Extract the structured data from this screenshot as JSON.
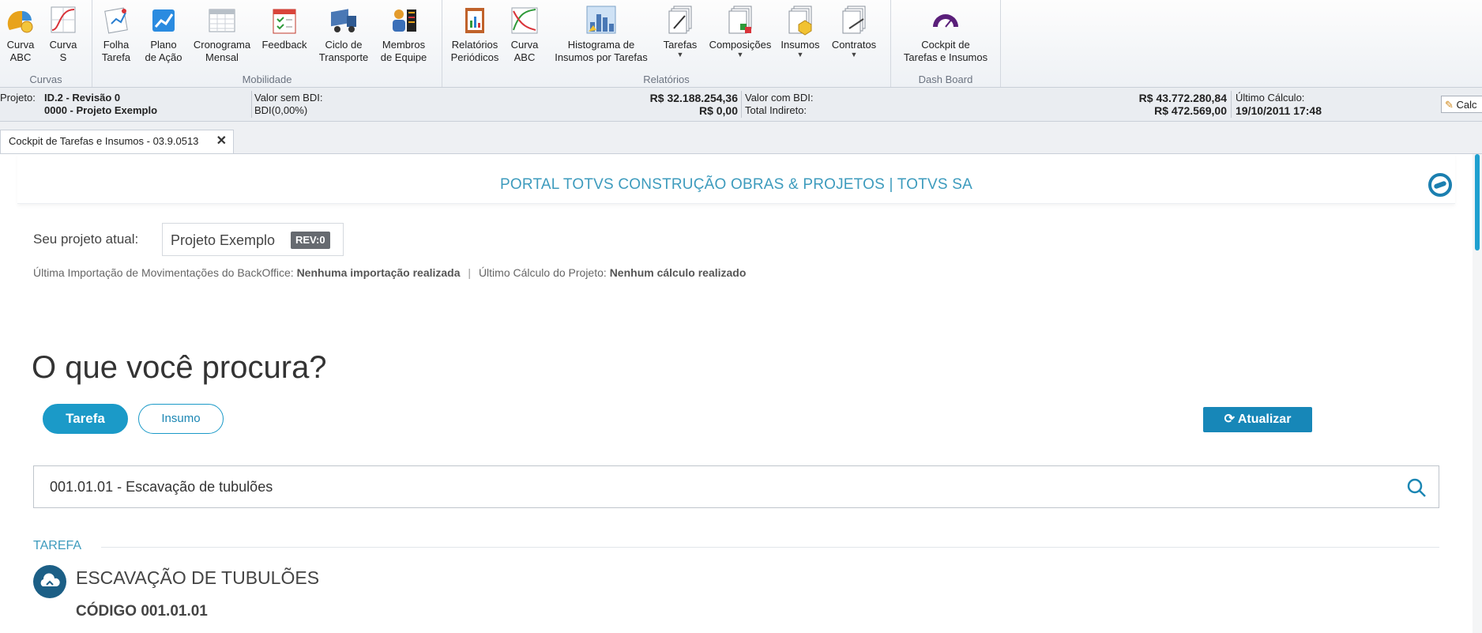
{
  "ribbon": {
    "groups": [
      {
        "label": "Curvas"
      },
      {
        "label": "Mobilidade"
      },
      {
        "label": "Relatórios"
      },
      {
        "label": "Dash Board"
      }
    ],
    "buttons": [
      {
        "label": "Curva\nABC",
        "icon": "abc-curve-icon"
      },
      {
        "label": "Curva\nS",
        "icon": "s-curve-icon"
      },
      {
        "label": "Folha\nTarefa",
        "icon": "task-sheet-icon"
      },
      {
        "label": "Plano\nde Ação",
        "icon": "action-plan-icon"
      },
      {
        "label": "Cronograma\nMensal",
        "icon": "monthly-schedule-icon"
      },
      {
        "label": "Feedback",
        "icon": "feedback-calendar-icon"
      },
      {
        "label": "Ciclo de\nTransporte",
        "icon": "truck-icon"
      },
      {
        "label": "Membros\nde Equipe",
        "icon": "team-members-icon"
      },
      {
        "label": "Relatórios\nPeriódicos",
        "icon": "periodic-reports-icon"
      },
      {
        "label": "Curva\nABC",
        "icon": "abc-curve-report-icon"
      },
      {
        "label": "Histograma de\nInsumos por Tarefas",
        "icon": "histogram-icon"
      },
      {
        "label": "Tarefas",
        "icon": "tasks-report-icon"
      },
      {
        "label": "Composições",
        "icon": "compositions-report-icon"
      },
      {
        "label": "Insumos",
        "icon": "inputs-report-icon"
      },
      {
        "label": "Contratos",
        "icon": "contracts-report-icon"
      },
      {
        "label": "Cockpit de\nTarefas e Insumos",
        "icon": "cockpit-gauge-icon"
      }
    ]
  },
  "infobar": {
    "project_label": "Projeto:",
    "project_id": "ID.2 - Revisão 0",
    "project_name": "0000 - Projeto Exemplo",
    "valor_sem_bdi_label": "Valor sem BDI:",
    "bdi_label": "BDI(0,00%)",
    "valor_sem_bdi": "R$ 32.188.254,36",
    "bdi_value": "R$ 0,00",
    "valor_com_bdi_label": "Valor com BDI:",
    "total_indireto_label": "Total Indireto:",
    "valor_com_bdi": "R$ 43.772.280,84",
    "total_indireto": "R$ 472.569,00",
    "ultimo_calculo_label": "Último Cálculo:",
    "ultimo_calculo": "19/10/2011 17:48",
    "calc_button": "Calc"
  },
  "tabs": [
    {
      "label": "Cockpit de Tarefas e Insumos - 03.9.0513",
      "close": "✕"
    }
  ],
  "portal": {
    "title": "PORTAL TOTVS CONSTRUÇÃO OBRAS & PROJETOS | TOTVS SA",
    "project_label": "Seu projeto atual:",
    "project_name": "Projeto Exemplo",
    "revision": "REV:0",
    "import_label": "Última Importação de Movimentações do BackOffice:",
    "import_value": "Nenhuma importação realizada",
    "calc_label": "Último Cálculo do Projeto:",
    "calc_value": "Nenhum cálculo realizado",
    "heading": "O que você procura?",
    "filters": [
      "Tarefa",
      "Insumo"
    ],
    "refresh": "Atualizar",
    "search_value": "001.01.01 - Escavação de tubulões",
    "section": "TAREFA",
    "task_title": "ESCAVAÇÃO DE TUBULÕES",
    "task_code": "CÓDIGO 001.01.01"
  },
  "colors": {
    "accent": "#1b9ac8",
    "title": "#3d9bbd",
    "task_icon": "#1c5f86"
  }
}
